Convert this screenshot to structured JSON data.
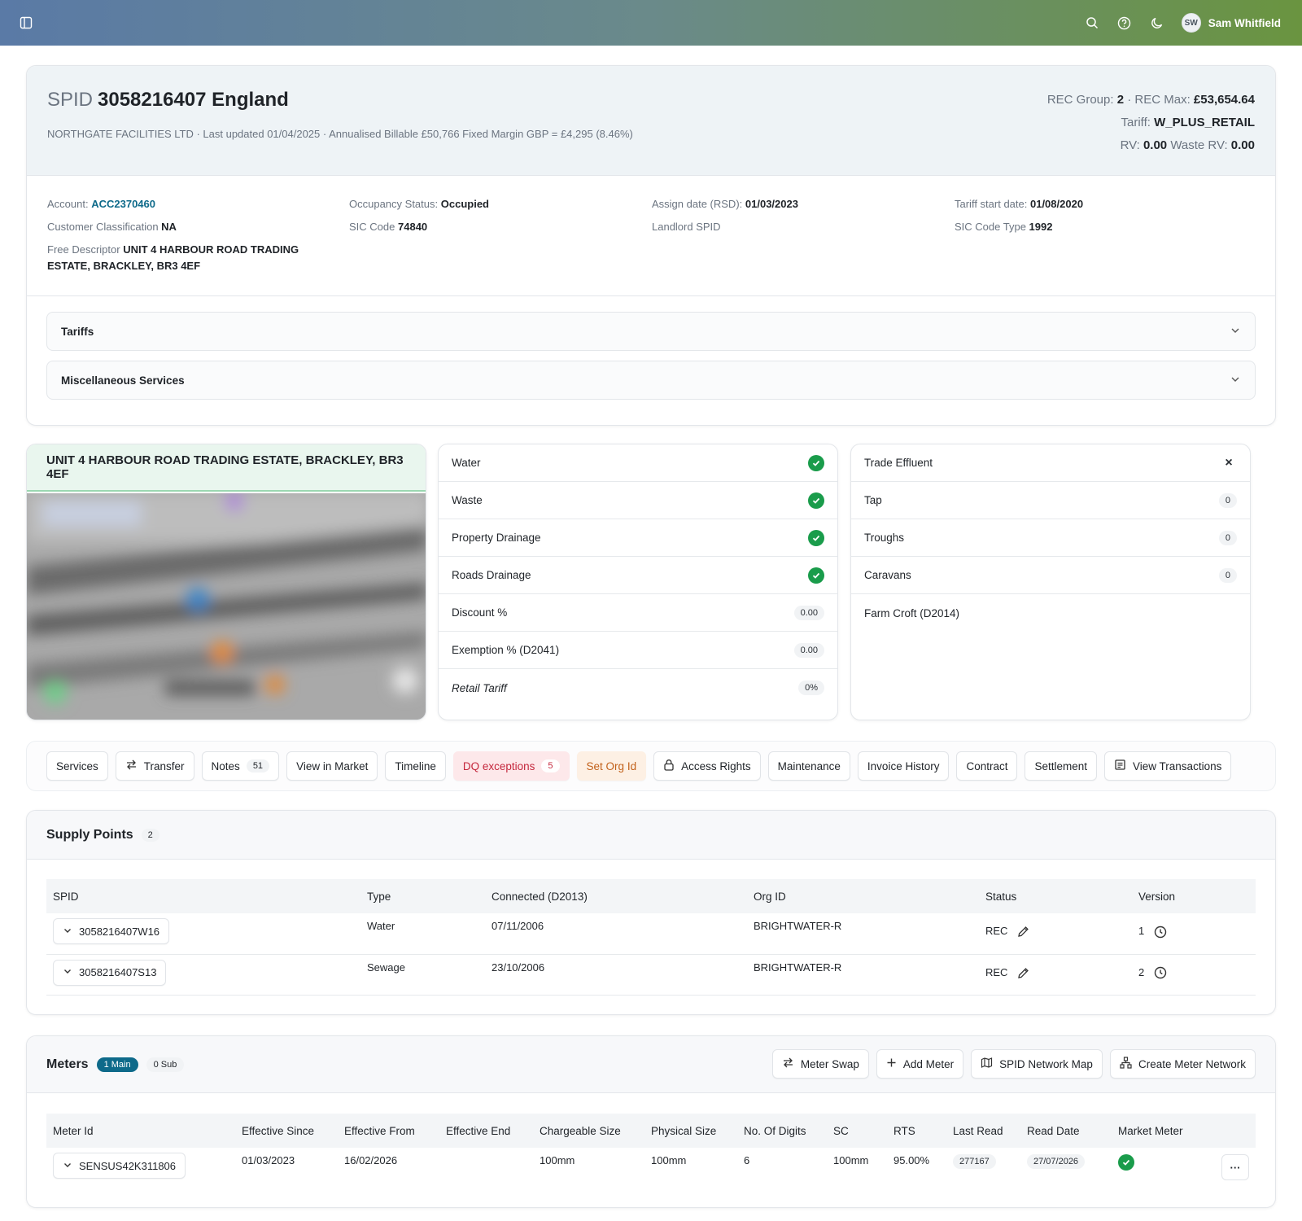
{
  "topbar": {
    "user_initials": "SW",
    "user_name": "Sam Whitfield"
  },
  "header": {
    "spid_label": "SPID",
    "spid_value": "3058216407 England",
    "subline": "NORTHGATE FACILITIES LTD · Last updated 01/04/2025 · Annualised Billable £50,766 Fixed Margin GBP = £4,295 (8.46%)",
    "rec_group_label": "REC Group:",
    "rec_group_value": "2",
    "rec_max_label": "· REC Max:",
    "rec_max_value": "£53,654.64",
    "tariff_label": "Tariff:",
    "tariff_value": "W_PLUS_RETAIL",
    "rv_label": "RV:",
    "rv_value": "0.00",
    "waste_rv_label": "Waste RV:",
    "waste_rv_value": "0.00"
  },
  "details": {
    "account_label": "Account:",
    "account_value": "ACC2370460",
    "customer_class_label": "Customer Classification",
    "customer_class_value": "NA",
    "free_desc_label": "Free Descriptor",
    "free_desc_value": "UNIT 4 HARBOUR ROAD TRADING ESTATE, BRACKLEY, BR3 4EF",
    "occupancy_label": "Occupancy Status:",
    "occupancy_value": "Occupied",
    "sic_label": "SIC Code",
    "sic_value": "74840",
    "assign_label": "Assign date (RSD):",
    "assign_value": "01/03/2023",
    "landlord_label": "Landlord SPID",
    "tariff_start_label": "Tariff start date:",
    "tariff_start_value": "01/08/2020",
    "sic_type_label": "SIC Code Type",
    "sic_type_value": "1992"
  },
  "accordions": {
    "tariffs": "Tariffs",
    "misc": "Miscellaneous Services"
  },
  "address_title": "UNIT 4 HARBOUR ROAD TRADING ESTATE, BRACKLEY, BR3 4EF",
  "services": [
    {
      "label": "Water",
      "state": "check"
    },
    {
      "label": "Waste",
      "state": "check"
    },
    {
      "label": "Property Drainage",
      "state": "check"
    },
    {
      "label": "Roads Drainage",
      "state": "check"
    },
    {
      "label": "Discount %",
      "value": "0.00"
    },
    {
      "label": "Exemption % (D2041)",
      "value": "0.00"
    },
    {
      "label": "Retail Tariff",
      "value": "0%"
    }
  ],
  "trade": [
    {
      "label": "Trade Effluent"
    },
    {
      "label": "Tap",
      "value": "0"
    },
    {
      "label": "Troughs",
      "value": "0"
    },
    {
      "label": "Caravans",
      "value": "0"
    },
    {
      "label": "Farm Croft (D2014)"
    }
  ],
  "tabs": {
    "services": "Services",
    "transfer": "Transfer",
    "notes": "Notes",
    "notes_count": "51",
    "view_market": "View in Market",
    "timeline": "Timeline",
    "dq": "DQ exceptions",
    "dq_count": "5",
    "set_org": "Set Org Id",
    "access": "Access Rights",
    "maintenance": "Maintenance",
    "invoice": "Invoice History",
    "contract": "Contract",
    "settlement": "Settlement",
    "transactions": "View Transactions"
  },
  "supply_points": {
    "title": "Supply Points",
    "count": "2",
    "columns": [
      "SPID",
      "Type",
      "Connected (D2013)",
      "Org ID",
      "Status",
      "Version"
    ],
    "rows": [
      {
        "spid": "3058216407W16",
        "type": "Water",
        "connected": "07/11/2006",
        "org": "BRIGHTWATER-R",
        "status": "REC",
        "version": "1"
      },
      {
        "spid": "3058216407S13",
        "type": "Sewage",
        "connected": "23/10/2006",
        "org": "BRIGHTWATER-R",
        "status": "REC",
        "version": "2"
      }
    ]
  },
  "meters": {
    "title": "Meters",
    "main_badge": "1 Main",
    "sub_badge": "0 Sub",
    "actions": {
      "swap": "Meter Swap",
      "add": "Add Meter",
      "network_map": "SPID Network Map",
      "create_network": "Create Meter Network"
    },
    "columns": [
      "Meter Id",
      "Effective Since",
      "Effective From",
      "Effective End",
      "Chargeable Size",
      "Physical Size",
      "No. Of Digits",
      "SC",
      "RTS",
      "Last Read",
      "Read Date",
      "Market Meter"
    ],
    "rows": [
      {
        "meter_id": "SENSUS42K311806",
        "since": "01/03/2023",
        "from": "16/02/2026",
        "end": "",
        "chargeable": "100mm",
        "physical": "100mm",
        "digits": "6",
        "sc": "100mm",
        "rts": "95.00%",
        "last_read": "277167",
        "read_date": "27/07/2026"
      }
    ]
  }
}
